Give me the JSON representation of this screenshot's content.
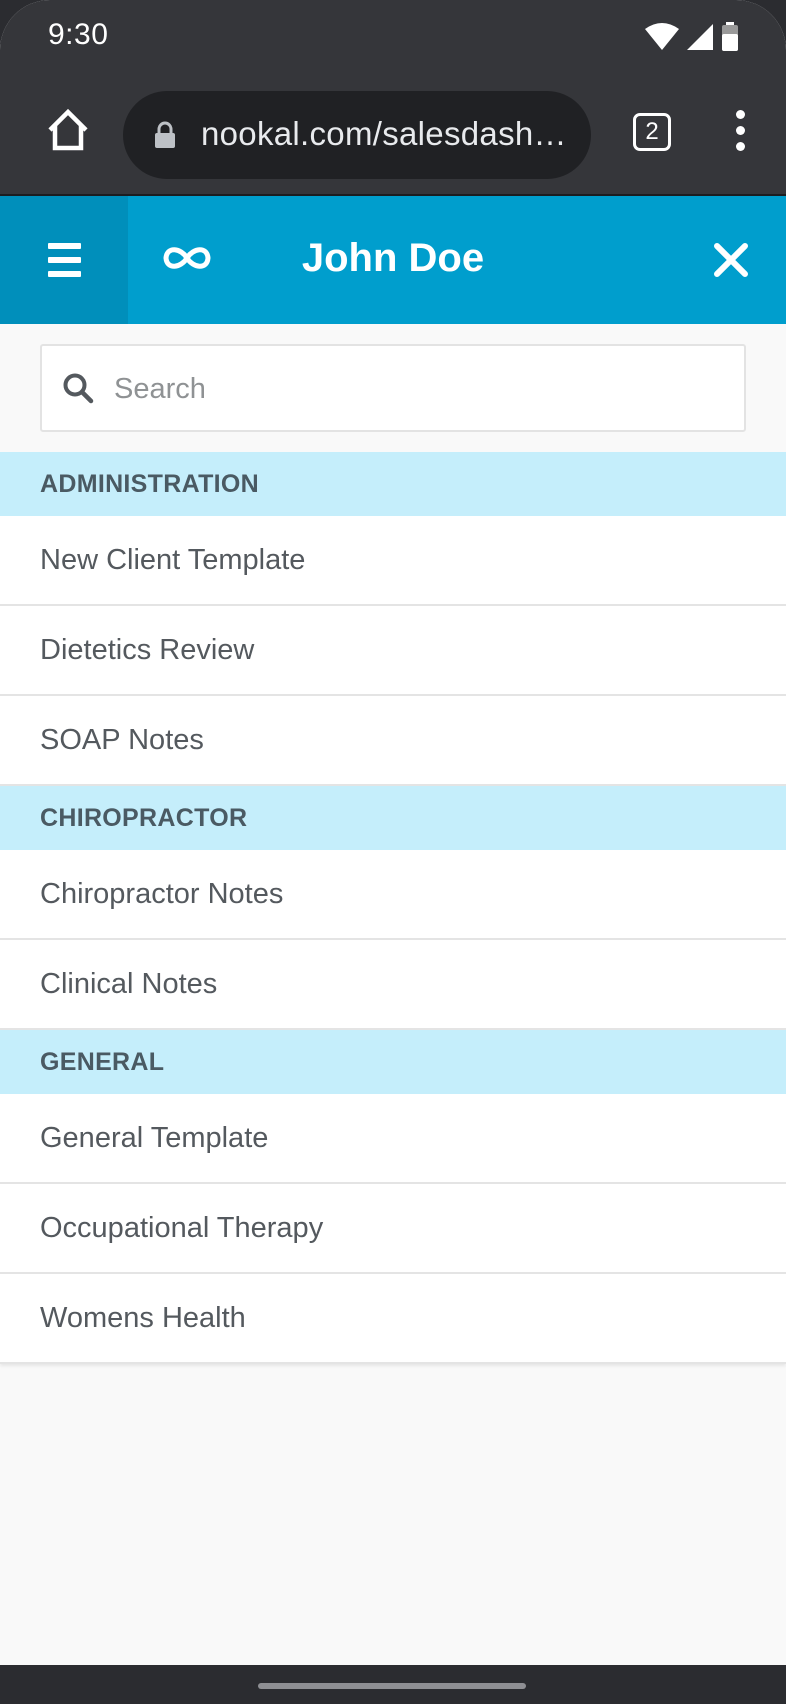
{
  "status_bar": {
    "time": "9:30"
  },
  "browser": {
    "url": "nookal.com/salesdash…",
    "tab_count": "2"
  },
  "header": {
    "title": "John Doe",
    "accent_color": "#009ecd"
  },
  "search": {
    "placeholder": "Search",
    "value": ""
  },
  "sections": [
    {
      "title": "ADMINISTRATION",
      "items": [
        "New Client Template",
        "Dietetics Review",
        "SOAP Notes"
      ]
    },
    {
      "title": "CHIROPRACTOR",
      "items": [
        "Chiropractor Notes",
        "Clinical Notes"
      ]
    },
    {
      "title": "GENERAL",
      "items": [
        "General Template",
        "Occupational Therapy",
        "Womens Health"
      ]
    }
  ],
  "icons": {
    "home": "home-icon",
    "lock": "lock-icon",
    "menu": "menu-dots-icon",
    "hamburger": "hamburger-icon",
    "logo": "infinity-logo-icon",
    "close": "close-icon",
    "search": "search-icon"
  }
}
